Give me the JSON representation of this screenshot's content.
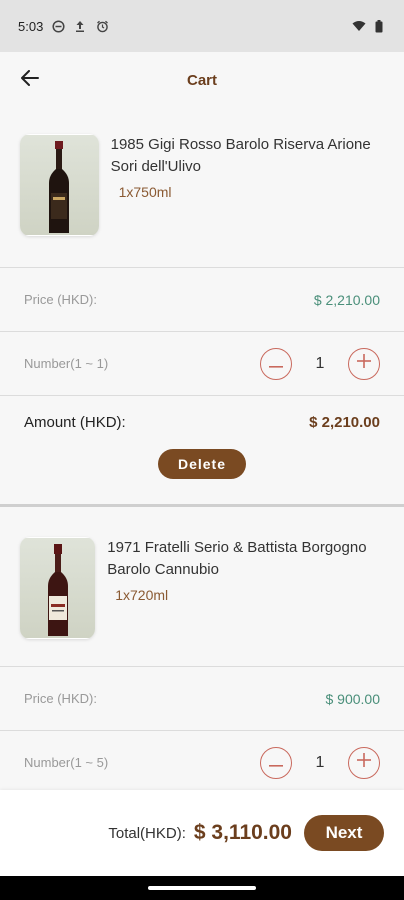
{
  "status_bar": {
    "time": "5:03"
  },
  "header": {
    "title": "Cart"
  },
  "items": [
    {
      "name": "1985 Gigi Rosso Barolo Riserva Arione Sori dell'Ulivo",
      "spec": "1x750ml",
      "price_label": "Price (HKD):",
      "price_value": "$ 2,210.00",
      "number_label": "Number(1 ~ 1)",
      "quantity": "1",
      "amount_label": "Amount (HKD):",
      "amount_value": "$ 2,210.00",
      "delete_label": "Delete"
    },
    {
      "name": "1971 Fratelli Serio & Battista Borgogno Barolo Cannubio",
      "spec": "1x720ml",
      "price_label": "Price (HKD):",
      "price_value": "$ 900.00",
      "number_label": "Number(1 ~ 5)",
      "quantity": "1"
    }
  ],
  "footer": {
    "total_label": "Total(HKD):",
    "total_value": "$ 3,110.00",
    "next_label": "Next"
  },
  "colors": {
    "accent": "#7a4a22",
    "title": "#6b3e1d",
    "price": "#4a8f7a",
    "stepper": "#c9695d"
  }
}
